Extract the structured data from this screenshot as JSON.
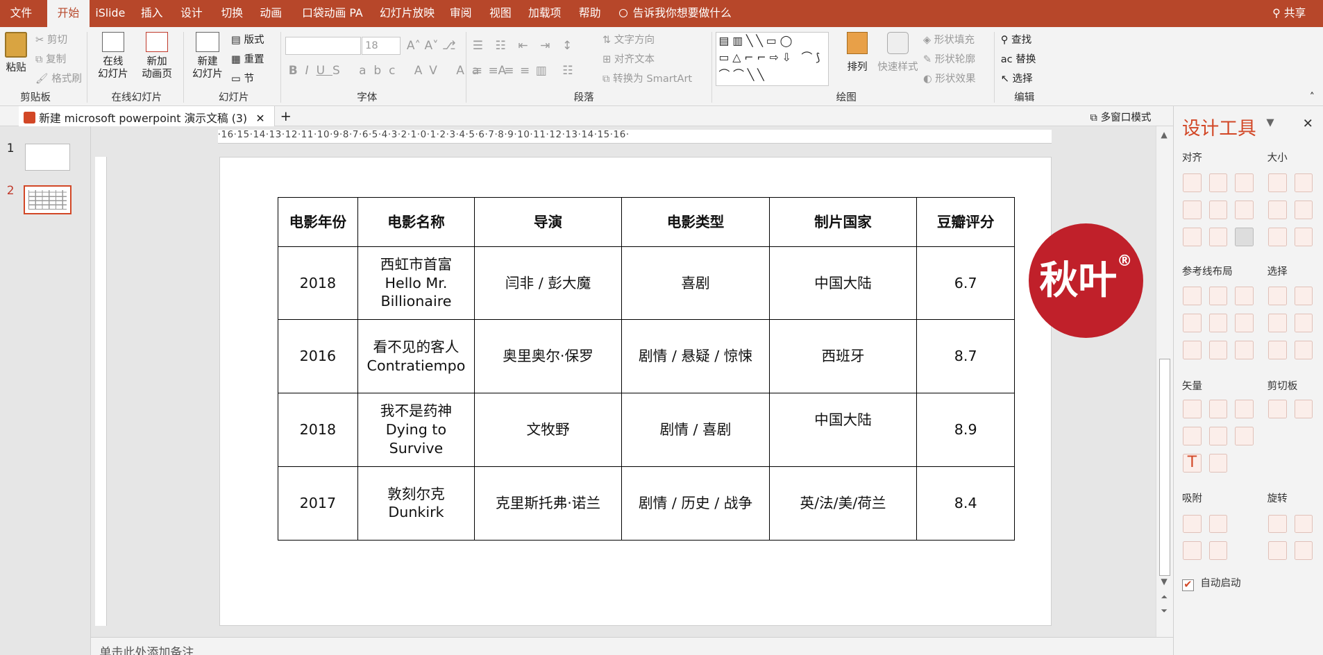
{
  "menu": {
    "file": "文件",
    "home": "开始",
    "islide": "iSlide",
    "insert": "插入",
    "design": "设计",
    "transitions": "切换",
    "animations": "动画",
    "pocket": "口袋动画 PA",
    "slideshow": "幻灯片放映",
    "review": "审阅",
    "view": "视图",
    "addins": "加载项",
    "help": "帮助",
    "tellme": "告诉我你想要做什么",
    "share": "共享"
  },
  "ribbon": {
    "paste": "粘贴",
    "cut": "剪切",
    "copy": "复制",
    "format_painter": "格式刷",
    "clipboard_group": "剪贴板",
    "online_slides": "在线\n幻灯片",
    "new_anim_page": "新加\n动画页",
    "online_group": "在线幻灯片",
    "new_slide": "新建\n幻灯片",
    "layout": "版式",
    "reset": "重置",
    "section": "节",
    "slides_group": "幻灯片",
    "font_size": "18",
    "font_group": "字体",
    "text_direction": "文字方向",
    "align_text": "对齐文本",
    "convert_smartart": "转换为 SmartArt",
    "paragraph_group": "段落",
    "arrange": "排列",
    "quick_styles": "快速样式",
    "shape_fill": "形状填充",
    "shape_outline": "形状轮廓",
    "shape_effects": "形状效果",
    "drawing_group": "绘图",
    "find": "查找",
    "replace": "替换",
    "select": "选择",
    "editing_group": "编辑"
  },
  "doc_tab": {
    "title": "新建 microsoft powerpoint 演示文稿 (3)",
    "multiwindow": "多窗口模式"
  },
  "thumbs": {
    "n1": "1",
    "n2": "2"
  },
  "ruler_h": "·16·15·14·13·12·11·10·9·8·7·6·5·4·3·2·1·0·1·2·3·4·5·6·7·8·9·10·11·12·13·14·15·16·",
  "table": {
    "headers": [
      "电影年份",
      "电影名称",
      "导演",
      "电影类型",
      "制片国家",
      "豆瓣评分"
    ],
    "rows": [
      {
        "year": "2018",
        "name": "西虹市首富\nHello Mr.\nBillionaire",
        "director": "闫非 / 彭大魔",
        "genre": "喜剧",
        "country": "中国大陆",
        "score": "6.7"
      },
      {
        "year": "2016",
        "name": "看不见的客人\nContratiempo",
        "director": "奥里奥尔·保罗",
        "genre": "剧情 / 悬疑 / 惊悚",
        "country": "西班牙",
        "score": "8.7"
      },
      {
        "year": "2018",
        "name": "我不是药神\nDying to\nSurvive",
        "director": "文牧野",
        "genre": "剧情 / 喜剧",
        "country": "中国大陆",
        "score": "8.9"
      },
      {
        "year": "2017",
        "name": "敦刻尔克\nDunkirk",
        "director": "克里斯托弗·诺兰",
        "genre": "剧情 / 历史 / 战争",
        "country": "英/法/美/荷兰",
        "score": "8.4"
      }
    ]
  },
  "logo": {
    "text": "秋叶",
    "mark": "®"
  },
  "notes": "单击此处添加备注",
  "pane": {
    "title": "设计工具",
    "align": "对齐",
    "size": "大小",
    "guides": "参考线布局",
    "select": "选择",
    "vector": "矢量",
    "clipboard": "剪切板",
    "snap": "吸附",
    "rotate": "旋转",
    "auto_start": "自动启动"
  },
  "colors": {
    "accent": "#b7472a",
    "logo": "#c0202a"
  }
}
